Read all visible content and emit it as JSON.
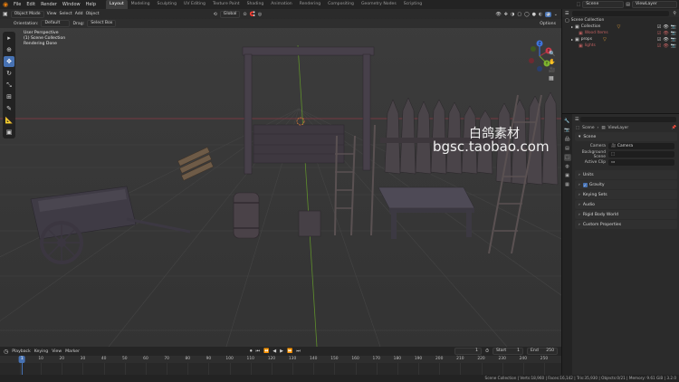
{
  "menubar": {
    "items": [
      "File",
      "Edit",
      "Render",
      "Window",
      "Help"
    ],
    "workspaces": [
      "Layout",
      "Modeling",
      "Sculpting",
      "UV Editing",
      "Texture Paint",
      "Shading",
      "Animation",
      "Rendering",
      "Compositing",
      "Geometry Nodes",
      "Scripting"
    ],
    "active_workspace": "Layout",
    "scene_name": "Scene",
    "view_layer": "ViewLayer"
  },
  "viewport": {
    "mode": "Object Mode",
    "menus": [
      "View",
      "Select",
      "Add",
      "Object"
    ],
    "transform_orientation": "Global",
    "orientation_label": "Orientation:",
    "orientation_value": "Default",
    "drag_label": "Drag:",
    "drag_value": "Select Box",
    "options_label": "Options",
    "overlay_lines": [
      "User Perspective",
      "(1) Scene Collection",
      "Rendering Done"
    ],
    "watermark_cn": "白鸽素材",
    "watermark_url": "bgsc.taobao.com",
    "gizmo_axes": [
      "X",
      "Y",
      "Z"
    ]
  },
  "toolbar": {
    "tools": [
      "cursor-select-icon",
      "cursor-icon",
      "move-icon",
      "rotate-icon",
      "scale-icon",
      "transform-icon",
      "annotate-icon",
      "measure-icon",
      "add-cube-icon"
    ],
    "active_index": 2
  },
  "outliner": {
    "root": "Scene Collection",
    "rows": [
      {
        "label": "Collection",
        "color": "#e0e0e0"
      },
      {
        "label": "Wood Items",
        "color": "#c06060"
      },
      {
        "label": "props",
        "color": "#e0e0e0"
      },
      {
        "label": "lights",
        "color": "#c06060"
      }
    ]
  },
  "properties": {
    "breadcrumb_scene": "Scene",
    "breadcrumb_viewlayer": "ViewLayer",
    "panel_scene": "Scene",
    "camera_label": "Camera",
    "camera_value": "Camera",
    "bg_scene_label": "Background Scene",
    "active_clip_label": "Active Clip",
    "panels": [
      "Units",
      "Gravity",
      "Keying Sets",
      "Audio",
      "Rigid Body World",
      "Custom Properties"
    ]
  },
  "timeline": {
    "menus": [
      "Playback",
      "Keying",
      "View",
      "Marker"
    ],
    "current_frame": "1",
    "start_label": "Start",
    "start_value": "1",
    "end_label": "End",
    "end_value": "250",
    "ticks": [
      "0",
      "10",
      "20",
      "30",
      "40",
      "50",
      "60",
      "70",
      "80",
      "90",
      "100",
      "110",
      "120",
      "130",
      "140",
      "150",
      "160",
      "170",
      "180",
      "190",
      "200",
      "210",
      "220",
      "230",
      "240",
      "250"
    ],
    "playhead": "1"
  },
  "statusbar": {
    "text": "Scene Collection | Verts:18,960 | Faces:16,142 | Tris:35,930 | Objects:0/21 | Memory: 9.61 GiB | 3.2.0"
  },
  "colors": {
    "accent": "#4772b3",
    "x_axis": "#a0343f",
    "y_axis": "#6a9a2a",
    "z_axis": "#3a6ad0"
  }
}
